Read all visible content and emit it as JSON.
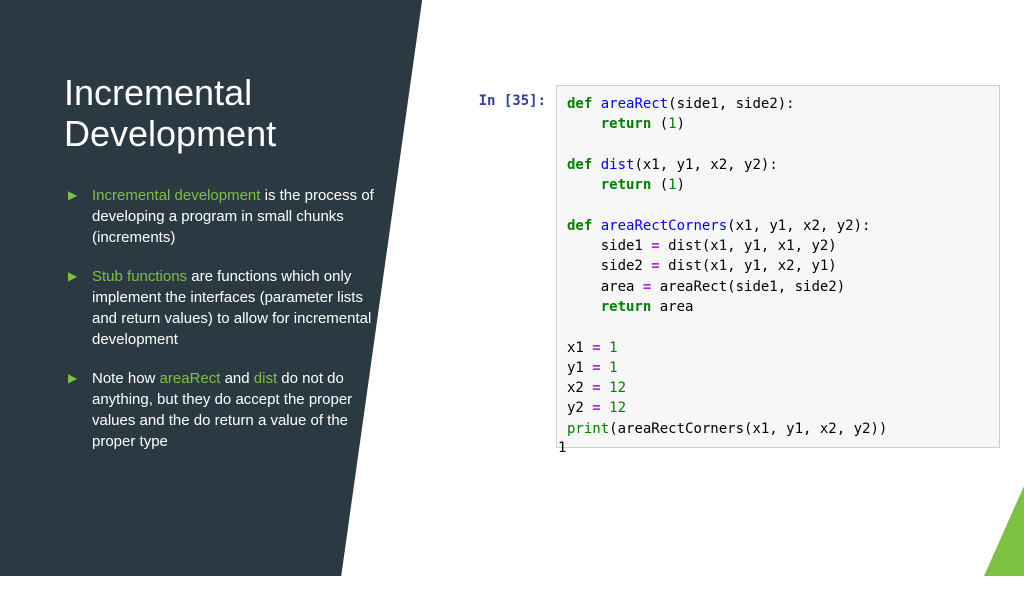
{
  "title": "Incremental Development",
  "bullets": {
    "b1": {
      "hl": "Incremental development",
      "rest": " is the process of developing a program in small chunks (increments)"
    },
    "b2": {
      "hl": "Stub functions",
      "rest": " are functions which only implement the interfaces (parameter lists and return values) to allow for incremental development"
    },
    "b3": {
      "pre": "Note how ",
      "hl1": "areaRect",
      "mid": " and ",
      "hl2": "dist",
      "rest": " do not do anything, but they do accept the proper values and the do return a value of the proper type"
    }
  },
  "prompt": "In [35]:",
  "code": {
    "l01_kw": "def",
    "l01_fn": "areaRect",
    "l01_rest": "(side1, side2):",
    "l02_kw": "return",
    "l02_num": "1",
    "l03_kw": "def",
    "l03_fn": "dist",
    "l03_rest": "(x1, y1, x2, y2):",
    "l04_kw": "return",
    "l04_num": "1",
    "l05_kw": "def",
    "l05_fn": "areaRectCorners",
    "l05_rest": "(x1, y1, x2, y2):",
    "l06": "    side1 ",
    "l06_op": "=",
    "l06_r": " dist(x1, y1, x1, y2)",
    "l07": "    side2 ",
    "l07_op": "=",
    "l07_r": " dist(x1, y1, x2, y1)",
    "l08": "    area ",
    "l08_op": "=",
    "l08_r": " areaRect(side1, side2)",
    "l09_kw": "return",
    "l09_r": " area",
    "l10": "x1 ",
    "l10_op": "=",
    "l10_n": " 1",
    "l11": "y1 ",
    "l11_op": "=",
    "l11_n": " 1",
    "l12": "x2 ",
    "l12_op": "=",
    "l12_n": " 12",
    "l13": "y2 ",
    "l13_op": "=",
    "l13_n": " 12",
    "l14_bi": "print",
    "l14_r": "(areaRectCorners(x1, y1, x2, y2))"
  },
  "output": "1"
}
